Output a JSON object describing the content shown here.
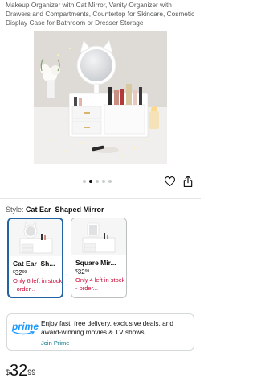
{
  "product": {
    "title": "Makeup Organizer with Cat Mirror, Vanity Organizer with Drawers and Compartments, Countertop for Skincare, Cosmetic Display Case for Bathroom or Dresser Storage"
  },
  "gallery": {
    "dot_count": 5,
    "active_index": 1
  },
  "style": {
    "label": "Style:",
    "selected": "Cat Ear–Shaped Mirror"
  },
  "options": [
    {
      "name": "Cat Ear–Sh...",
      "price_currency": "$",
      "price_whole": "32",
      "price_fraction": "99",
      "stock": "Only 6 left in stock - order..."
    },
    {
      "name": "Square Mir...",
      "price_currency": "$",
      "price_whole": "32",
      "price_fraction": "99",
      "stock": "Only 4 left in stock - order..."
    }
  ],
  "prime": {
    "logo": "prime",
    "text": "Enjoy fast, free delivery, exclusive deals, and award-winning movies & TV shows.",
    "link": "Join Prime"
  },
  "price": {
    "currency": "$",
    "whole": "32",
    "fraction": "99"
  },
  "colors": {
    "selected_border": "#2162a1",
    "stock_red": "#cc0c39",
    "link_teal": "#007185",
    "prime_blue": "#1a98ff"
  }
}
